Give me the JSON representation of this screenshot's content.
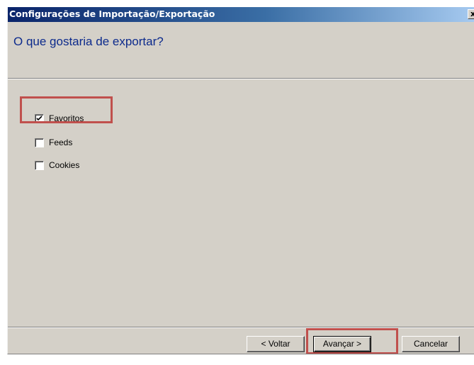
{
  "window": {
    "title": "Configurações de Importação/Exportação",
    "close_label": "x"
  },
  "header": {
    "question": "O que gostaria de exportar?"
  },
  "options": [
    {
      "label": "Favoritos",
      "checked": true
    },
    {
      "label": "Feeds",
      "checked": false
    },
    {
      "label": "Cookies",
      "checked": false
    }
  ],
  "buttons": {
    "back_label": "< Voltar",
    "next_label": "Avançar >",
    "cancel_label": "Cancelar"
  },
  "colors": {
    "title_gradient_start": "#0a246a",
    "title_gradient_end": "#a6caf0",
    "question_text": "#0c2a8c",
    "dialog_face": "#d4d0c8",
    "highlight": "#c0504d"
  }
}
